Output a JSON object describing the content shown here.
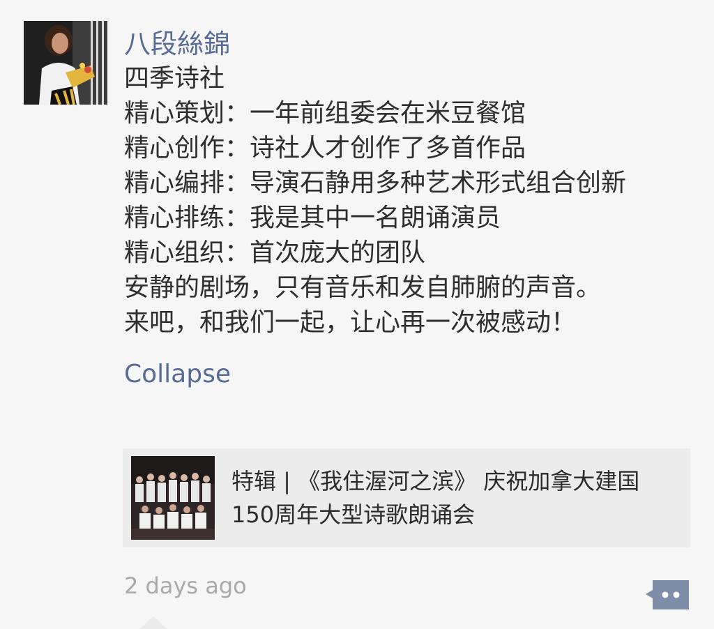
{
  "post": {
    "author": "八段絲錦",
    "lines": [
      "四季诗社",
      "精心策划：一年前组委会在米豆餐馆",
      "精心创作：诗社人才创作了多首作品",
      "精心编排：导演石静用多种艺术形式组合创新",
      "精心排练：我是其中一名朗诵演员",
      "精心组织：首次庞大的团队",
      "安静的剧场，只有音乐和发自肺腑的声音。",
      "来吧，和我们一起，让心再一次被感动！"
    ],
    "collapse_label": "Collapse"
  },
  "link_card": {
    "title": "特辑 | 《我住渥河之滨》 庆祝加拿大建国150周年大型诗歌朗诵会"
  },
  "footer": {
    "timestamp": "2 days ago"
  },
  "colors": {
    "link_blue": "#576b95",
    "background": "#f6f6f6",
    "card_bg": "#ececec",
    "comment_button": "#7f8ea8"
  },
  "icons": {
    "comment": "comment-bubble-icon"
  }
}
